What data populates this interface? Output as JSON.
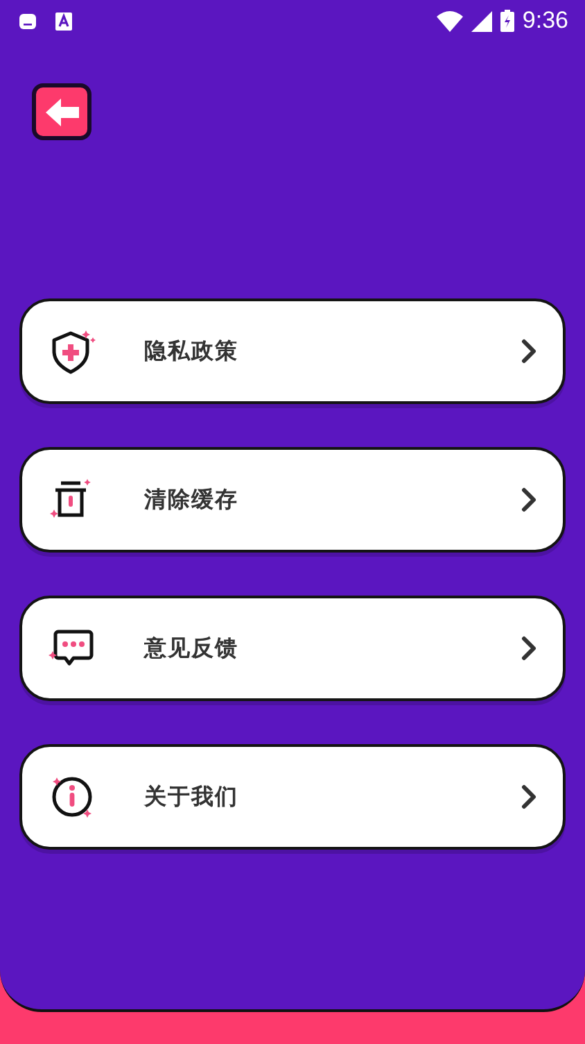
{
  "status_bar": {
    "time": "9:36"
  },
  "menu": [
    {
      "kind": "shield",
      "label": "隐私政策"
    },
    {
      "kind": "trash",
      "label": "清除缓存"
    },
    {
      "kind": "chat",
      "label": "意见反馈"
    },
    {
      "kind": "info",
      "label": "关于我们"
    }
  ]
}
